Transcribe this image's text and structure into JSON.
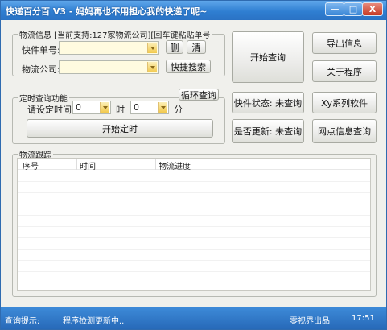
{
  "titlebar": {
    "title": "快递百分百 V3 - 妈妈再也不用担心我的快递了呢~",
    "min_label": "—",
    "max_label": "□",
    "close_label": "X"
  },
  "query_group": {
    "legend": "物流信息 [当前支持:127家物流公司][回车键粘贴单号",
    "waybill_label": "快件单号:",
    "company_label": "物流公司:",
    "delete_label": "删",
    "clear_label": "清",
    "quick_search_label": "快捷搜索"
  },
  "timer_group": {
    "legend": "定时查询功能",
    "loop_label": "循环查询",
    "set_time_label": "请设定时间:",
    "hour_value": "0",
    "hour_unit": "时",
    "minute_value": "0",
    "minute_unit": "分",
    "start_timer_label": "开始定时"
  },
  "actions": {
    "start_query": "开始查询",
    "export_info": "导出信息",
    "about": "关于程序",
    "waybill_status": "快件状态: 未查询",
    "xy_software": "Xy系列软件",
    "is_updated": "是否更新: 未查询",
    "outlet_query": "网点信息查询"
  },
  "tracking": {
    "legend": "物流跟踪",
    "columns": [
      "序号",
      "时间",
      "物流进度"
    ]
  },
  "statusbar": {
    "prompt_label": "查询提示:",
    "message": "程序检测更新中..",
    "vendor": "零视界出品",
    "clock": "17:51"
  }
}
